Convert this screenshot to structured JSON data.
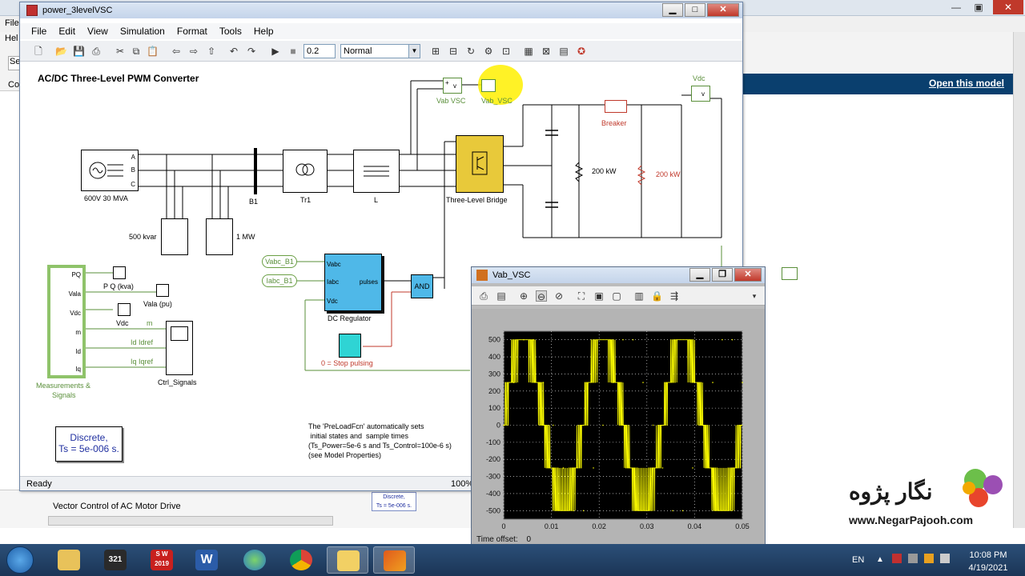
{
  "background": {
    "menu_file": "File",
    "menu_help": "Hel",
    "search_stub": "Se",
    "co_stub": "Co",
    "open_model_link": "Open this model",
    "lower_item": "Vector Control of AC Motor Drive",
    "discrete_small_line1": "Discrete,",
    "discrete_small_line2": "Ts = 5e-006 s."
  },
  "sim_window": {
    "title": "power_3levelVSC",
    "menu": [
      "File",
      "Edit",
      "View",
      "Simulation",
      "Format",
      "Tools",
      "Help"
    ],
    "stop_time": "0.2",
    "sim_mode": "Normal",
    "status": "Ready",
    "status_right": "100%",
    "model_title": "AC/DC Three-Level PWM Converter",
    "blocks": {
      "source": "600V 30 MVA",
      "b1": "B1",
      "tr1": "Tr1",
      "l": "L",
      "bridge": "Three-Level Bridge",
      "cap_bank": "500 kvar",
      "load": "1 MW",
      "vab_vsc": "Vab VSC",
      "vab_vsc_scope": "Vab_VSC",
      "vdc_meas": "Vdc",
      "breaker": "Breaker",
      "r1": "200 kW",
      "r2": "200 kW",
      "vabc_tag": "Vabc_B1",
      "iabc_tag": "Iabc_B1",
      "dc_reg": "DC Regulator",
      "dc_reg_vabc": "Vabc",
      "dc_reg_iabc": "Iabc",
      "dc_reg_vdc": "Vdc",
      "dc_reg_pulses": "pulses",
      "and": "AND",
      "stop_pulsing": "0 = Stop pulsing",
      "pq_scope": "P Q (kva)",
      "vala_scope": "Vala (pu)",
      "vdc_scope": "Vdc",
      "ctrl_signals": "Ctrl_Signals",
      "meas": "Measurements &",
      "meas2": "Signals",
      "meas_ports": [
        "PQ",
        "Vala",
        "Vdc",
        "m",
        "Id",
        "Iq"
      ],
      "sig_m": "m",
      "sig_id": "Id Idref",
      "sig_iq": "Iq Iqref",
      "discrete_l1": "Discrete,",
      "discrete_l2": "Ts = 5e-006 s.",
      "note": "The 'PreLoadFcn' automatically sets\n initial states and  sample times\n(Ts_Power=5e-6 s and Ts_Control=100e-6 s)\n(see Model Properties)"
    }
  },
  "scope_window": {
    "title": "Vab_VSC",
    "time_offset_label": "Time offset:",
    "time_offset_value": "0"
  },
  "chart_data": {
    "type": "line",
    "title": "",
    "xlabel": "",
    "ylabel": "",
    "xlim": [
      0,
      0.05
    ],
    "ylim": [
      -550,
      550
    ],
    "xticks": [
      "0",
      "0.01",
      "0.02",
      "0.03",
      "0.04",
      "0.05"
    ],
    "yticks": [
      "500",
      "400",
      "300",
      "200",
      "100",
      "0",
      "-100",
      "-200",
      "-300",
      "-400",
      "-500"
    ],
    "grid": true,
    "series": [
      {
        "fundamental_hz": 60,
        "step_levels": [
          0,
          250,
          500,
          -250,
          -500
        ],
        "x": [
          0,
          0.0021,
          0.0042,
          0.0062,
          0.0083,
          0.0104,
          0.0125,
          0.0146,
          0.0167,
          0.0188,
          0.0208,
          0.0229,
          0.025,
          0.0271,
          0.0292,
          0.0313,
          0.0333,
          0.0354,
          0.0375,
          0.0396,
          0.0417,
          0.0438,
          0.0458,
          0.0479,
          0.05
        ],
        "y": [
          0,
          250,
          500,
          500,
          250,
          0,
          -250,
          -500,
          -500,
          -250,
          0,
          250,
          500,
          500,
          250,
          0,
          -250,
          -500,
          -500,
          -250,
          0,
          250,
          500,
          500,
          250
        ]
      }
    ],
    "colors": {
      "trace": "#ffff00",
      "background": "#000000",
      "grid": "#ffffff"
    }
  },
  "watermark": {
    "name": "نگار پژوه",
    "url": "www.NegarPajooh.com"
  },
  "taskbar": {
    "lang": "EN",
    "time": "10:08 PM",
    "date": "4/19/2021",
    "apps": [
      "explorer",
      "media-player",
      "solidworks",
      "word",
      "network",
      "chrome",
      "folder",
      "matlab"
    ],
    "sw_label": "S W",
    "sw_year": "2019",
    "word_label": "W",
    "mp_label": "321"
  }
}
